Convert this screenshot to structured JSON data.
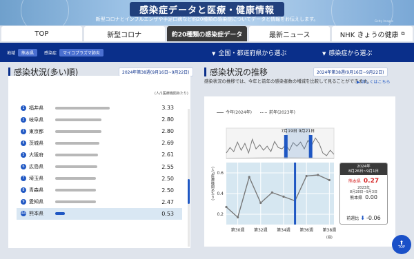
{
  "banner": {
    "title": "感染症データと医療・健康情報",
    "subtitle": "新型コロナとインフルエンザや手足口病など約20種類の感染症についてデータと情報をお伝えします。",
    "credit": "Getty Images"
  },
  "tabs": [
    {
      "label": "TOP"
    },
    {
      "label": "新型コロナ"
    },
    {
      "label": "約20種類の感染症データ"
    },
    {
      "label": "最新ニュース"
    },
    {
      "label": "NHK きょうの健康"
    }
  ],
  "filters": {
    "area_label": "地域",
    "area_value": "熊本県",
    "disease_label": "感染症",
    "disease_value": "マイコプラズマ肺炎",
    "select_region": "全国・都道府県から選ぶ",
    "select_disease": "感染症から選ぶ"
  },
  "ranking": {
    "title": "感染状況(多い順)",
    "period": "2024年第38週(9月16日~9月22日)",
    "unit": "(人/1医療機関あたり)",
    "max": 3.33,
    "rows": [
      {
        "rank": "1",
        "name": "福井県",
        "value": 3.33
      },
      {
        "rank": "2",
        "name": "岐阜県",
        "value": 2.8
      },
      {
        "rank": "3",
        "name": "東京都",
        "value": 2.8
      },
      {
        "rank": "4",
        "name": "茨城県",
        "value": 2.69
      },
      {
        "rank": "5",
        "name": "大阪府",
        "value": 2.61
      },
      {
        "rank": "6",
        "name": "広島県",
        "value": 2.55
      },
      {
        "rank": "7",
        "name": "埼玉県",
        "value": 2.5
      },
      {
        "rank": "8",
        "name": "青森県",
        "value": 2.5
      },
      {
        "rank": "9",
        "name": "愛知県",
        "value": 2.47
      },
      {
        "rank": "44",
        "name": "熊本県",
        "value": 0.53,
        "highlight": true
      }
    ],
    "values_text": [
      "3.33",
      "2.80",
      "2.80",
      "2.69",
      "2.61",
      "2.55",
      "2.50",
      "2.50",
      "2.47",
      "0.53"
    ]
  },
  "trend": {
    "title": "感染状況の推移",
    "period": "2024年第38週(9月16日~9月22日)",
    "description": "感染状況の推移では、今年と前年の感染者数の増減を比較して見ることができます。",
    "detail_link": "詳しくはこちら",
    "legend_current": "今年(2024年)",
    "legend_previous": "前年(2023年)",
    "brush_label": "7月19日 9月21日",
    "ylabel": "(人/1医療機関あたり)",
    "xlabel": "(週)"
  },
  "infobox": {
    "header": "2024年\n8月26日~9月1日",
    "current_pref": "熊本県",
    "current_value": "0.27",
    "prev_header": "2023年\n8月28日~9月3日",
    "prev_pref": "熊本県",
    "prev_value": "0.00",
    "diff_label": "前週比",
    "diff_value": "-0.06"
  },
  "top_button": {
    "label": "TOP"
  },
  "chart_data": {
    "type": "line",
    "title": "感染状況の推移",
    "ylabel": "(人/1医療機関あたり)",
    "xlabel": "(週)",
    "x": [
      29,
      30,
      31,
      32,
      33,
      34,
      35,
      36,
      37,
      38
    ],
    "xticks": [
      "第30週",
      "第32週",
      "第34週",
      "第36週",
      "第38週"
    ],
    "xtick_values": [
      30,
      32,
      34,
      36,
      38
    ],
    "yticks": [
      "0.2",
      "0.4",
      "0.6"
    ],
    "ytick_values": [
      0.2,
      0.4,
      0.6
    ],
    "ylim": [
      0.1,
      0.7
    ],
    "xlim": [
      29,
      38.4
    ],
    "series": [
      {
        "name": "今年(2024年)",
        "values": [
          0.27,
          0.17,
          0.56,
          0.31,
          0.41,
          0.37,
          0.33,
          0.57,
          0.58,
          0.53
        ]
      }
    ],
    "selected_x": 35,
    "overview": {
      "series": [
        0.2,
        0.4,
        0.25,
        0.6,
        0.3,
        0.55,
        0.2,
        0.7,
        0.35,
        0.5,
        0.3,
        0.45,
        0.25,
        0.62,
        0.4,
        0.35,
        0.5,
        0.3,
        0.58,
        0.45,
        0.6,
        0.35,
        0.66,
        0.48,
        0.75,
        0.55,
        0.2,
        0.1,
        0.3,
        0.15
      ],
      "brush_start": 0.55,
      "brush_end": 0.78
    },
    "grid": true,
    "legend": "top-left"
  }
}
